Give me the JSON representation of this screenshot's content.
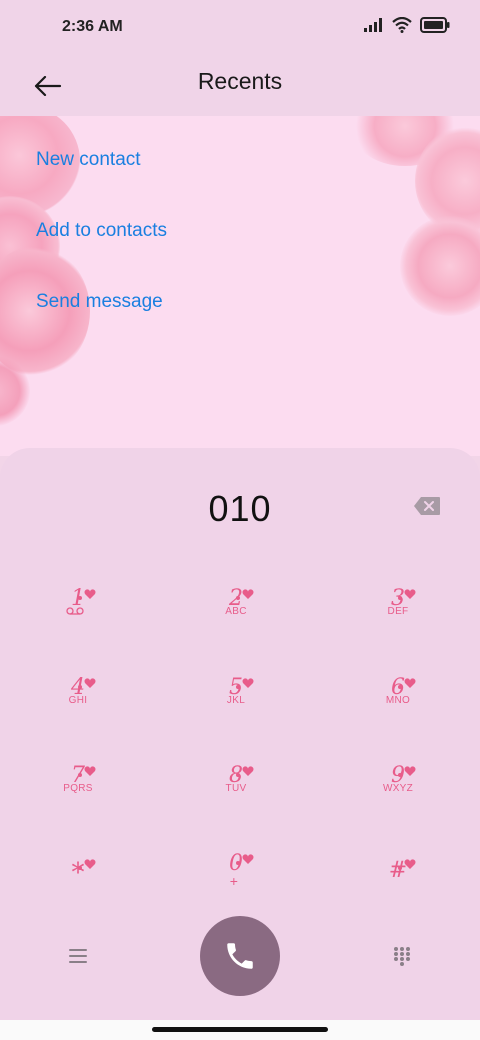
{
  "status_bar": {
    "time": "2:36 AM"
  },
  "header": {
    "title": "Recents"
  },
  "actions": [
    {
      "label": "New contact"
    },
    {
      "label": "Add to contacts"
    },
    {
      "label": "Send message"
    }
  ],
  "dialer": {
    "number": "010",
    "keys": [
      {
        "digit": "1",
        "letters": "",
        "sub_icon": "voicemail-icon"
      },
      {
        "digit": "2",
        "letters": "ABC"
      },
      {
        "digit": "3",
        "letters": "DEF"
      },
      {
        "digit": "4",
        "letters": "GHI"
      },
      {
        "digit": "5",
        "letters": "JKL"
      },
      {
        "digit": "6",
        "letters": "MNO"
      },
      {
        "digit": "7",
        "letters": "PQRS"
      },
      {
        "digit": "8",
        "letters": "TUV"
      },
      {
        "digit": "9",
        "letters": "WXYZ"
      },
      {
        "digit": "*",
        "letters": ""
      },
      {
        "digit": "0",
        "letters": "+"
      },
      {
        "digit": "#",
        "letters": ""
      }
    ]
  },
  "icons": {
    "back": "back-arrow-icon",
    "delete": "backspace-icon",
    "menu": "menu-icon",
    "call": "phone-icon",
    "keypad": "keypad-icon"
  },
  "colors": {
    "key_accent": "#e85c8a",
    "action_link": "#1a7fe0",
    "call_button": "#8a6a82",
    "panel_bg": "#f0d3e8"
  }
}
